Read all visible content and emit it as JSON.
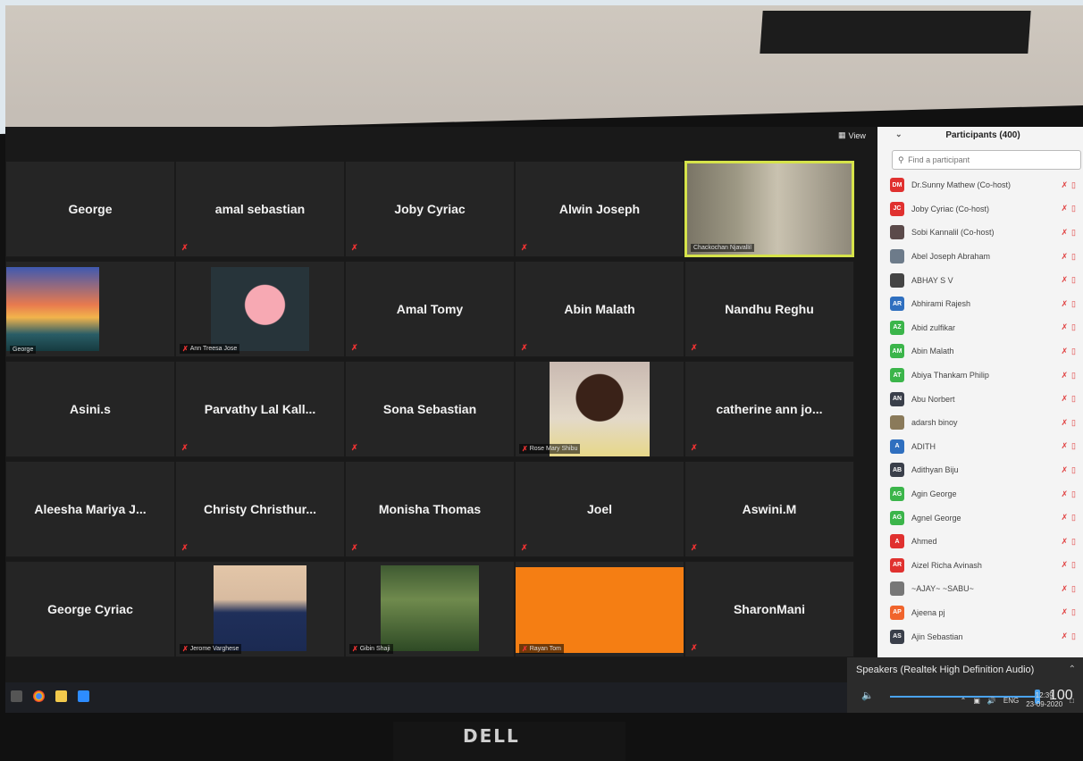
{
  "view_label": "View",
  "tiles": [
    {
      "name": "George",
      "muted": false,
      "photo": null
    },
    {
      "name": "amal sebastian",
      "muted": true,
      "photo": null
    },
    {
      "name": "Joby Cyriac",
      "muted": true,
      "photo": null
    },
    {
      "name": "Alwin Joseph",
      "muted": true,
      "photo": null
    },
    {
      "name": "",
      "label": "Chackochan Njavallil",
      "muted": false,
      "photo": "speaker",
      "active": true
    },
    {
      "name": "",
      "label": "George",
      "muted": false,
      "photo": "sky"
    },
    {
      "name": "",
      "label": "Ann Treesa Jose",
      "muted": true,
      "photo": "silhouette"
    },
    {
      "name": "Amal Tomy",
      "muted": true,
      "photo": null
    },
    {
      "name": "Abin Malath",
      "muted": true,
      "photo": null
    },
    {
      "name": "Nandhu Reghu",
      "muted": true,
      "photo": null
    },
    {
      "name": "Asini.s",
      "muted": false,
      "photo": null
    },
    {
      "name": "Parvathy Lal Kall...",
      "muted": true,
      "photo": null
    },
    {
      "name": "Sona Sebastian",
      "muted": true,
      "photo": null
    },
    {
      "name": "",
      "label": "Rose Mary Shibu",
      "muted": true,
      "photo": "rose"
    },
    {
      "name": "catherine ann jo...",
      "muted": true,
      "photo": null
    },
    {
      "name": "Aleesha Mariya J...",
      "muted": false,
      "photo": null
    },
    {
      "name": "Christy Christhur...",
      "muted": true,
      "photo": null
    },
    {
      "name": "Monisha Thomas",
      "muted": true,
      "photo": null
    },
    {
      "name": "Joel",
      "muted": true,
      "photo": null
    },
    {
      "name": "Aswini.M",
      "muted": true,
      "photo": null
    },
    {
      "name": "George Cyriac",
      "muted": false,
      "photo": null
    },
    {
      "name": "",
      "label": "Jerome Varghese",
      "muted": true,
      "photo": "jerome"
    },
    {
      "name": "",
      "label": "Gibin Shaji",
      "muted": true,
      "photo": "gibin"
    },
    {
      "name": "",
      "label": "Rayan Tom",
      "muted": true,
      "photo": "orange"
    },
    {
      "name": "SharonMani",
      "muted": true,
      "photo": null
    }
  ],
  "panel": {
    "title": "Participants (400)",
    "search_placeholder": "Find a participant",
    "participants": [
      {
        "initials": "DM",
        "color": "#e0312f",
        "name": "Dr.Sunny Mathew (Co-host)"
      },
      {
        "initials": "JC",
        "color": "#e0312f",
        "name": "Joby Cyriac (Co-host)"
      },
      {
        "initials": "",
        "color": "#5b4a4a",
        "name": "Sobi Kannalil (Co-host)"
      },
      {
        "initials": "",
        "color": "#6d7b8a",
        "name": "Abel Joseph Abraham"
      },
      {
        "initials": "",
        "color": "#444444",
        "name": "ABHAY S V"
      },
      {
        "initials": "AR",
        "color": "#2f6fbf",
        "name": "Abhirami Rajesh"
      },
      {
        "initials": "AZ",
        "color": "#3bb54a",
        "name": "Abid zulfikar"
      },
      {
        "initials": "AM",
        "color": "#3bb54a",
        "name": "Abin Malath"
      },
      {
        "initials": "AT",
        "color": "#3bb54a",
        "name": "Abiya Thankam Philip"
      },
      {
        "initials": "AN",
        "color": "#3a3f4a",
        "name": "Abu Norbert"
      },
      {
        "initials": "",
        "color": "#8a7a5a",
        "name": "adarsh binoy"
      },
      {
        "initials": "A",
        "color": "#2f6fbf",
        "name": "ADITH"
      },
      {
        "initials": "AB",
        "color": "#3a3f4a",
        "name": "Adithyan Biju"
      },
      {
        "initials": "AG",
        "color": "#3bb54a",
        "name": "Agin George"
      },
      {
        "initials": "AG",
        "color": "#3bb54a",
        "name": "Agnel George"
      },
      {
        "initials": "A",
        "color": "#e0312f",
        "name": "Ahmed"
      },
      {
        "initials": "AR",
        "color": "#e0312f",
        "name": "Aizel Richa Avinash"
      },
      {
        "initials": "",
        "color": "#777777",
        "name": "~AJAY~ ~SABU~"
      },
      {
        "initials": "AP",
        "color": "#f0642c",
        "name": "Ajeena pj"
      },
      {
        "initials": "AS",
        "color": "#3a3f4a",
        "name": "Ajin Sebastian"
      }
    ]
  },
  "speaker": {
    "title": "Speakers (Realtek High Definition Audio)",
    "volume": "100"
  },
  "tray": {
    "lang": "ENG",
    "time": "12:39",
    "date": "23-09-2020"
  },
  "monitor_brand": "DELL"
}
